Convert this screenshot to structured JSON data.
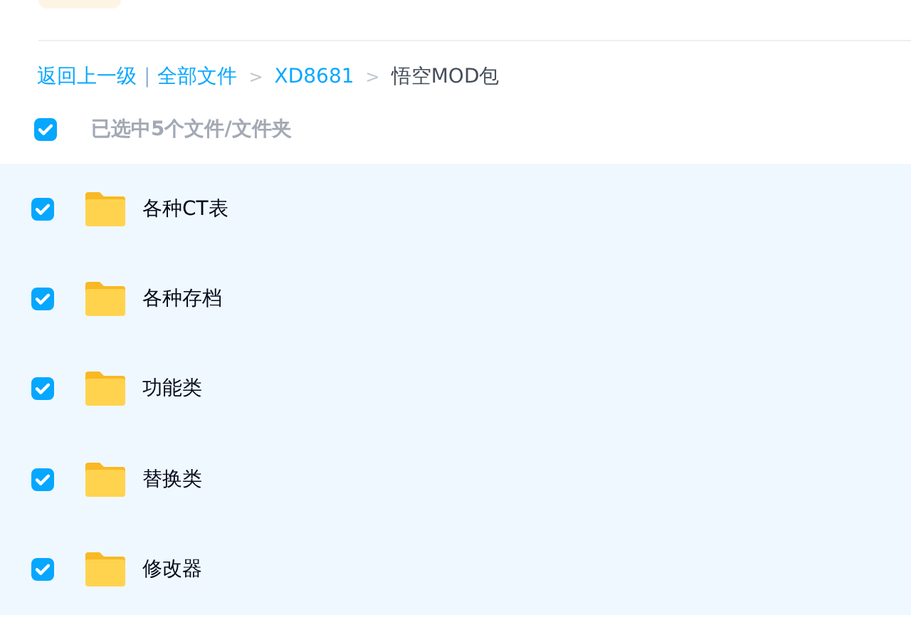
{
  "breadcrumb": {
    "back": "返回上一级",
    "separator": "|",
    "items": [
      {
        "label": "全部文件",
        "current": false
      },
      {
        "label": "XD8681",
        "current": false
      },
      {
        "label": "悟空MOD包",
        "current": true
      }
    ],
    "arrow": ">"
  },
  "select_all": {
    "checked": true,
    "label": "已选中5个文件/文件夹"
  },
  "files": [
    {
      "name": "各种CT表",
      "checked": true
    },
    {
      "name": "各种存档",
      "checked": true
    },
    {
      "name": "功能类",
      "checked": true
    },
    {
      "name": "替换类",
      "checked": true
    },
    {
      "name": "修改器",
      "checked": true
    }
  ]
}
